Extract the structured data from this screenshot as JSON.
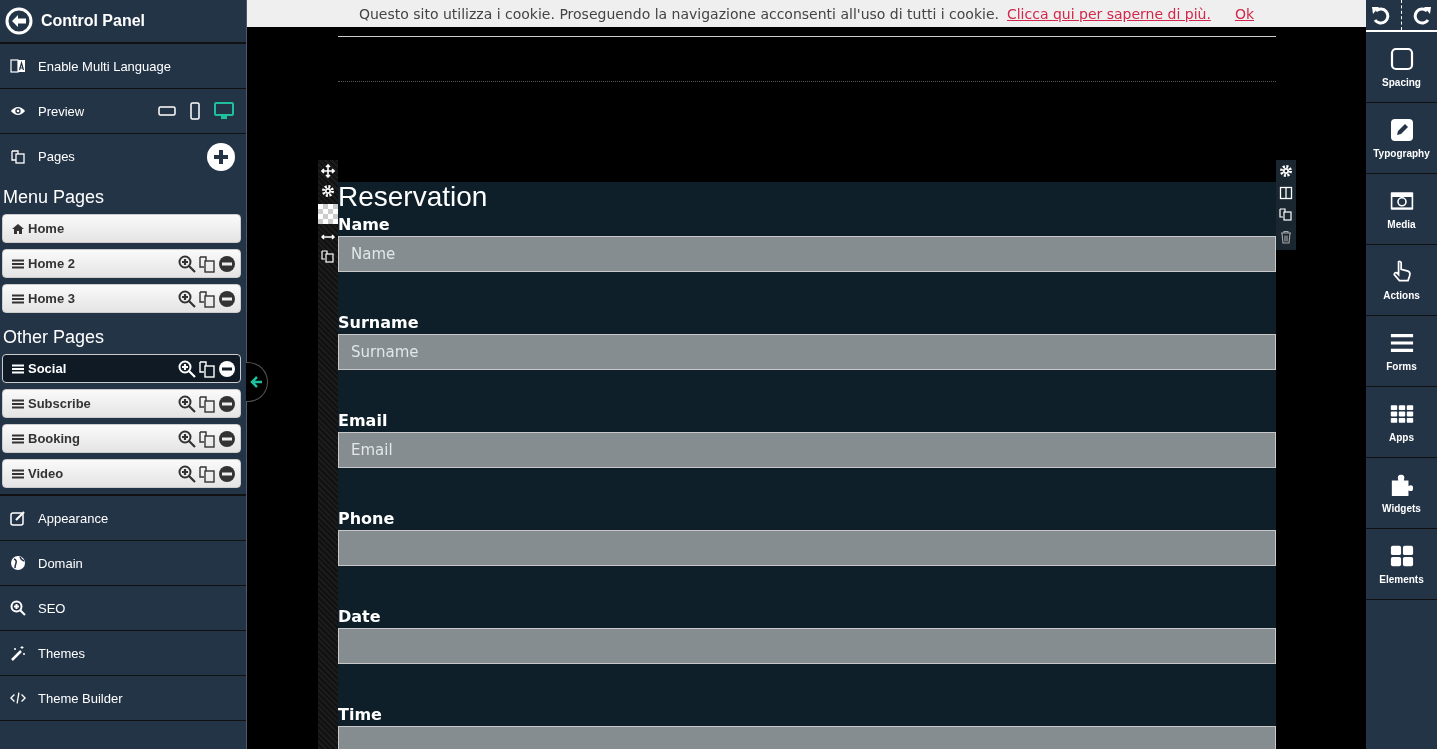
{
  "cookie_bar": {
    "message": "Questo sito utilizza i cookie. Proseguendo la navigazione acconsenti all'uso di tutti i cookie.",
    "link": "Clicca qui per saperne di più.",
    "ok": "Ok"
  },
  "sidebar": {
    "title": "Control Panel",
    "multi_language": "Enable Multi Language",
    "preview": {
      "label": "Preview",
      "devices": [
        {
          "kind": "tablet",
          "selected": false
        },
        {
          "kind": "phone",
          "selected": false
        },
        {
          "kind": "desktop",
          "selected": true
        }
      ]
    },
    "pages_label": "Pages",
    "page_groups": [
      {
        "heading": "Menu Pages",
        "pages": [
          {
            "label": "Home",
            "kind": "home",
            "selected": false
          },
          {
            "label": "Home 2",
            "kind": "page",
            "selected": false
          },
          {
            "label": "Home 3",
            "kind": "page",
            "selected": false
          }
        ]
      },
      {
        "heading": "Other Pages",
        "pages": [
          {
            "label": "Social",
            "kind": "page",
            "selected": true
          },
          {
            "label": "Subscribe",
            "kind": "page",
            "selected": false
          },
          {
            "label": "Booking",
            "kind": "page",
            "selected": false
          },
          {
            "label": "Video",
            "kind": "page",
            "selected": false
          }
        ]
      }
    ],
    "nav": [
      "Appearance",
      "Domain",
      "SEO",
      "Themes",
      "Theme Builder"
    ]
  },
  "tools": [
    "Spacing",
    "Typography",
    "Media",
    "Actions",
    "Forms",
    "Apps",
    "Widgets",
    "Elements"
  ],
  "form": {
    "title": "Reservation",
    "fields": [
      {
        "label": "Name",
        "placeholder": "Name"
      },
      {
        "label": "Surname",
        "placeholder": "Surname"
      },
      {
        "label": "Email",
        "placeholder": "Email"
      },
      {
        "label": "Phone"
      },
      {
        "label": "Date"
      },
      {
        "label": "Time"
      }
    ]
  }
}
